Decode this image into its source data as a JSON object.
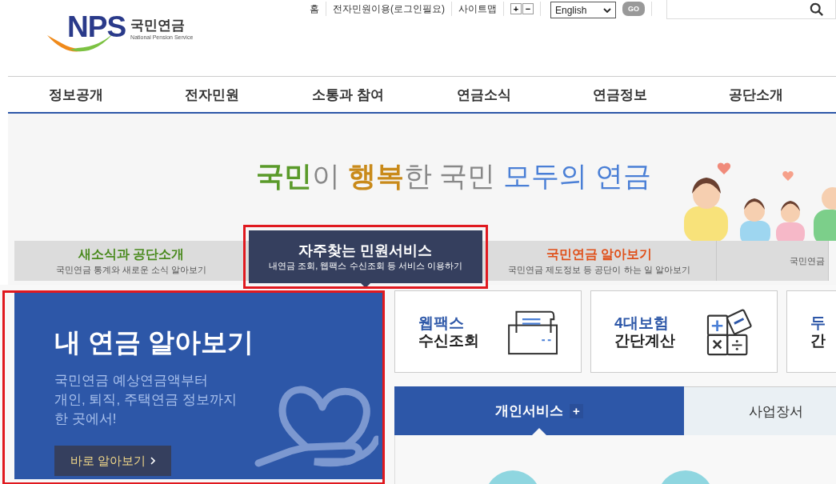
{
  "logo": {
    "mark": "NPS",
    "name": "국민연금",
    "english": "National Pension Service"
  },
  "utility_links": [
    "홈",
    "전자민원이용(로그인필요)",
    "사이트맵"
  ],
  "font_size_buttons": [
    "+",
    "−"
  ],
  "language_select": {
    "value": "English"
  },
  "go_button": "GO",
  "nav": [
    "정보공개",
    "전자민원",
    "소통과 참여",
    "연금소식",
    "연금정보",
    "공단소개"
  ],
  "slogan": [
    {
      "text": "국민",
      "color": "#5a9a2a",
      "bold": true
    },
    {
      "text": "이 ",
      "color": "#888888",
      "bold": false
    },
    {
      "text": "행복",
      "color": "#c98a1a",
      "bold": true
    },
    {
      "text": "한 국민 ",
      "color": "#888888",
      "bold": false
    },
    {
      "text": "모두의 연금",
      "color": "#4a7fd6",
      "bold": false
    }
  ],
  "hero_tabs": [
    {
      "title": "새소식과 공단소개",
      "subtitle": "국민연금 통계와 새로운 소식 알아보기",
      "selected": false,
      "highlighted": false
    },
    {
      "title": "자주찾는 민원서비스",
      "subtitle": "내연금 조회, 웹팩스 수신조회 등 서비스 이용하기",
      "selected": true,
      "highlighted": true
    },
    {
      "title": "국민연금 알아보기",
      "subtitle": "국민연금 제도정보 등 공단이 하는 일 알아보기",
      "selected": false,
      "highlighted": false
    },
    {
      "subtitle": "국민연금",
      "selected": false,
      "highlighted": false
    }
  ],
  "feature": {
    "title": "내 연금 알아보기",
    "description": "국민연금 예상연금액부터\n개인, 퇴직, 주택연금 정보까지\n한 곳에서!",
    "button": "바로 알아보기",
    "highlighted": true
  },
  "services": [
    {
      "top": "웹팩스",
      "bottom": "수신조회",
      "kind": "fax"
    },
    {
      "top": "4대보험",
      "bottom": "간단계산",
      "kind": "calculator"
    },
    {
      "top": "두",
      "bottom": "간",
      "kind": "none"
    }
  ],
  "service_tabs": [
    {
      "label": "개인서비스",
      "selected": true
    },
    {
      "label": "사업장서",
      "selected": false
    }
  ],
  "expand_sign": "+"
}
